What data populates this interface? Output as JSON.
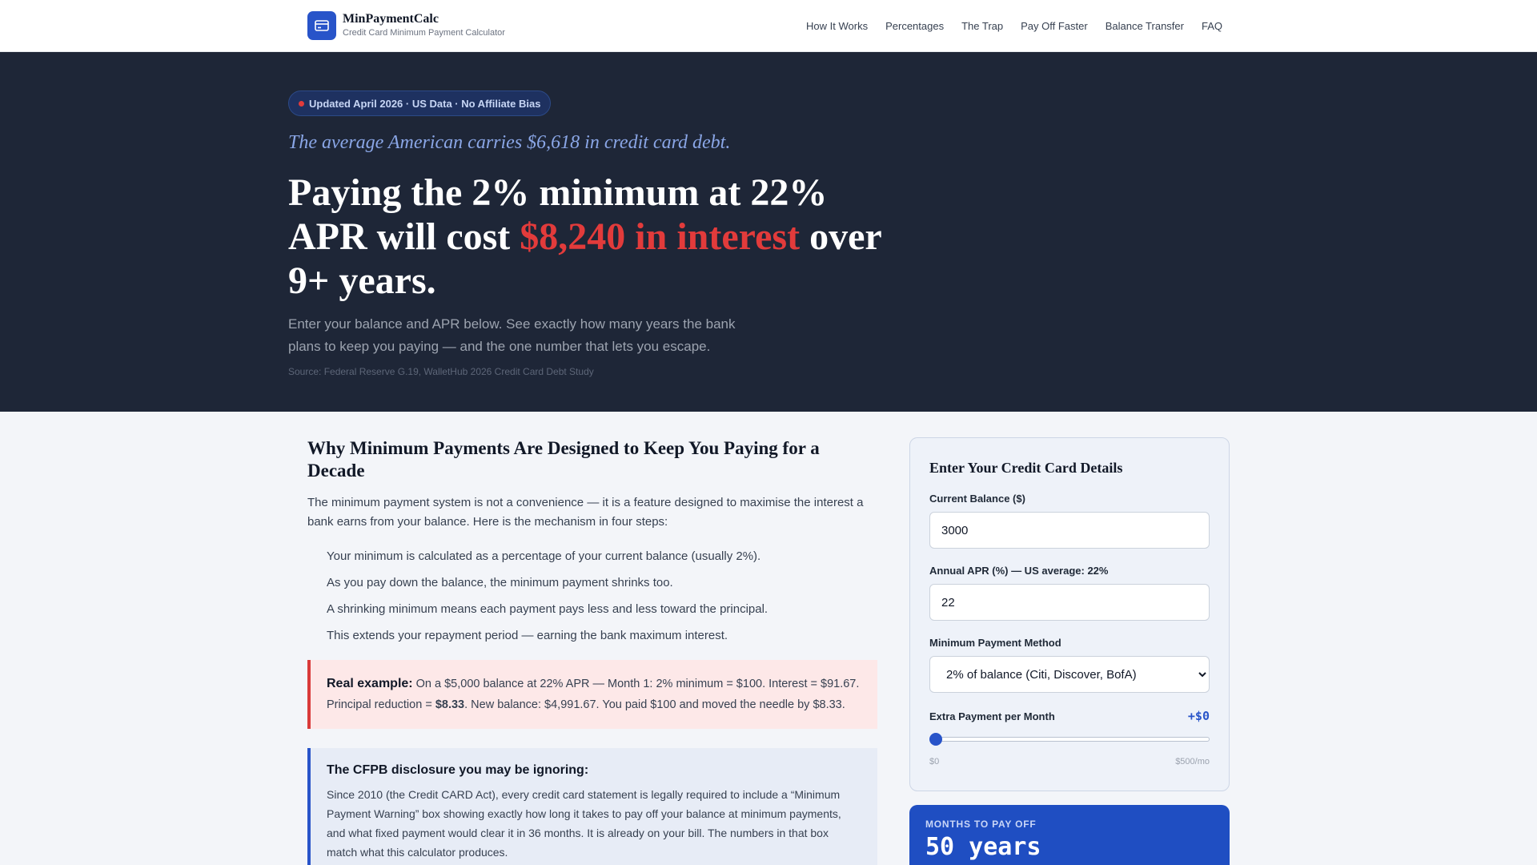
{
  "brand": {
    "name": "MinPaymentCalc",
    "subtitle": "Credit Card Minimum Payment Calculator",
    "icon": "credit-card-icon"
  },
  "nav": {
    "items": [
      "How It Works",
      "Percentages",
      "The Trap",
      "Pay Off Faster",
      "Balance Transfer",
      "FAQ"
    ]
  },
  "hero": {
    "badge": "Updated April 2026 · US Data · No Affiliate Bias",
    "tagline": "The average American carries $6,618 in credit card debt.",
    "title_before": "Paying the 2% minimum at 22% APR will cost ",
    "title_highlight": "$8,240 in interest",
    "title_after": " over 9+ years.",
    "description": "Enter your balance and APR below. See exactly how many years the bank plans to keep you paying — and the one number that lets you escape.",
    "source": "Source: Federal Reserve G.19, WalletHub 2026 Credit Card Debt Study"
  },
  "article": {
    "heading": "Why Minimum Payments Are Designed to Keep You Paying for a Decade",
    "intro": "The minimum payment system is not a convenience — it is a feature designed to maximise the interest a bank earns from your balance. Here is the mechanism in four steps:",
    "steps": [
      "Your minimum is calculated as a percentage of your current balance (usually 2%).",
      "As you pay down the balance, the minimum payment shrinks too.",
      "A shrinking minimum means each payment pays less and less toward the principal.",
      "This extends your repayment period — earning the bank maximum interest."
    ],
    "example": {
      "lead": "Real example:",
      "text_1": " On a $5,000 balance at 22% APR — Month 1: 2% minimum = $100. Interest = $91.67. Principal reduction = ",
      "bold": "$8.33",
      "text_2": ". New balance: $4,991.67. You paid $100 and moved the needle by $8.33."
    },
    "cfpb": {
      "heading": "The CFPB disclosure you may be ignoring:",
      "text": "Since 2010 (the Credit CARD Act), every credit card statement is legally required to include a “Minimum Payment Warning” box showing exactly how long it takes to pay off your balance at minimum payments, and what fixed payment would clear it in 36 months. It is already on your bill. The numbers in that box match what this calculator produces."
    }
  },
  "calculator": {
    "title": "Enter Your Credit Card Details",
    "balance_label": "Current Balance ($)",
    "balance_value": "3000",
    "apr_label": "Annual APR (%) — US average: 22%",
    "apr_value": "22",
    "method_label": "Minimum Payment Method",
    "method_selected": "2% of balance (Citi, Discover, BofA)",
    "extra_label": "Extra Payment per Month",
    "extra_value": "+$0",
    "extra_fraction": 0,
    "slider_min_label": "$0",
    "slider_max_label": "$500/mo"
  },
  "result": {
    "label": "MONTHS TO PAY OFF",
    "value": "50 years"
  },
  "colors": {
    "accent": "#2854c9",
    "alert": "#e23b3b",
    "hero_bg": "#1e2637"
  }
}
